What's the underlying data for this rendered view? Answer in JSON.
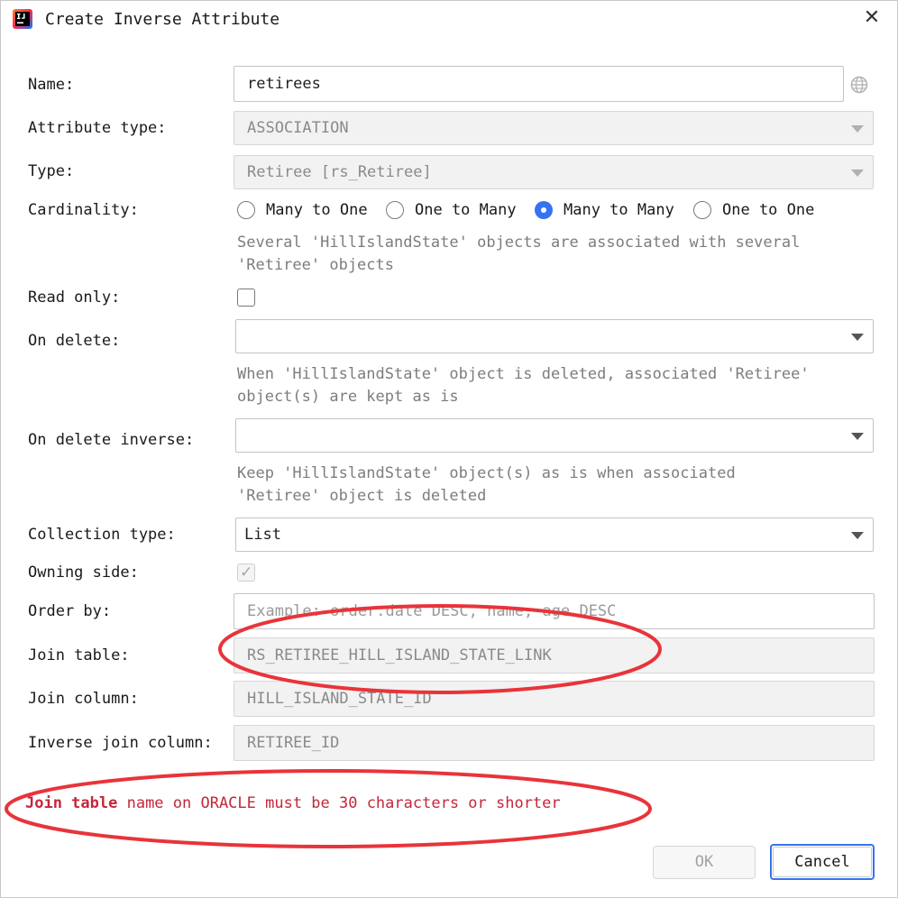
{
  "window": {
    "title": "Create Inverse Attribute",
    "close_glyph": "✕"
  },
  "form": {
    "name": {
      "label": "Name:",
      "value": "retirees"
    },
    "attribute_type": {
      "label": "Attribute type:",
      "value": "ASSOCIATION"
    },
    "type": {
      "label": "Type:",
      "value": "Retiree [rs_Retiree]"
    },
    "cardinality": {
      "label": "Cardinality:",
      "options": [
        "Many to One",
        "One to Many",
        "Many to Many",
        "One to One"
      ],
      "selected": "Many to Many",
      "hint_line1": "Several 'HillIslandState' objects are associated with several",
      "hint_line2": "'Retiree' objects"
    },
    "read_only": {
      "label": "Read only:",
      "checked": false
    },
    "on_delete": {
      "label": "On delete:",
      "value": "",
      "hint_line1": "When 'HillIslandState' object is deleted, associated 'Retiree'",
      "hint_line2": "object(s) are kept as is"
    },
    "on_delete_inverse": {
      "label": "On delete inverse:",
      "value": "",
      "hint_line1": "Keep 'HillIslandState' object(s) as is when associated",
      "hint_line2": "'Retiree' object is deleted"
    },
    "collection_type": {
      "label": "Collection type:",
      "value": "List"
    },
    "owning_side": {
      "label": "Owning side:",
      "checked": true
    },
    "order_by": {
      "label": "Order by:",
      "placeholder": "Example: order.date DESC, name, age DESC"
    },
    "join_table": {
      "label": "Join table:",
      "value": "RS_RETIREE_HILL_ISLAND_STATE_LINK"
    },
    "join_column": {
      "label": "Join column:",
      "value": "HILL_ISLAND_STATE_ID"
    },
    "inverse_join_column": {
      "label": "Inverse join column:",
      "value": "RETIREE_ID"
    }
  },
  "error": {
    "field": "Join table",
    "message": " name on ORACLE must be 30 characters or shorter"
  },
  "buttons": {
    "ok": "OK",
    "cancel": "Cancel"
  },
  "colors": {
    "accent": "#3574f0",
    "error_text": "#c4273a",
    "annotation_ellipse": "#e8343a",
    "disabled_text": "#8a8a8a"
  },
  "icons": {
    "app": "intellij-idea-icon",
    "globe": "globe-icon",
    "close": "close-icon",
    "dropdown": "chevron-down-icon"
  }
}
